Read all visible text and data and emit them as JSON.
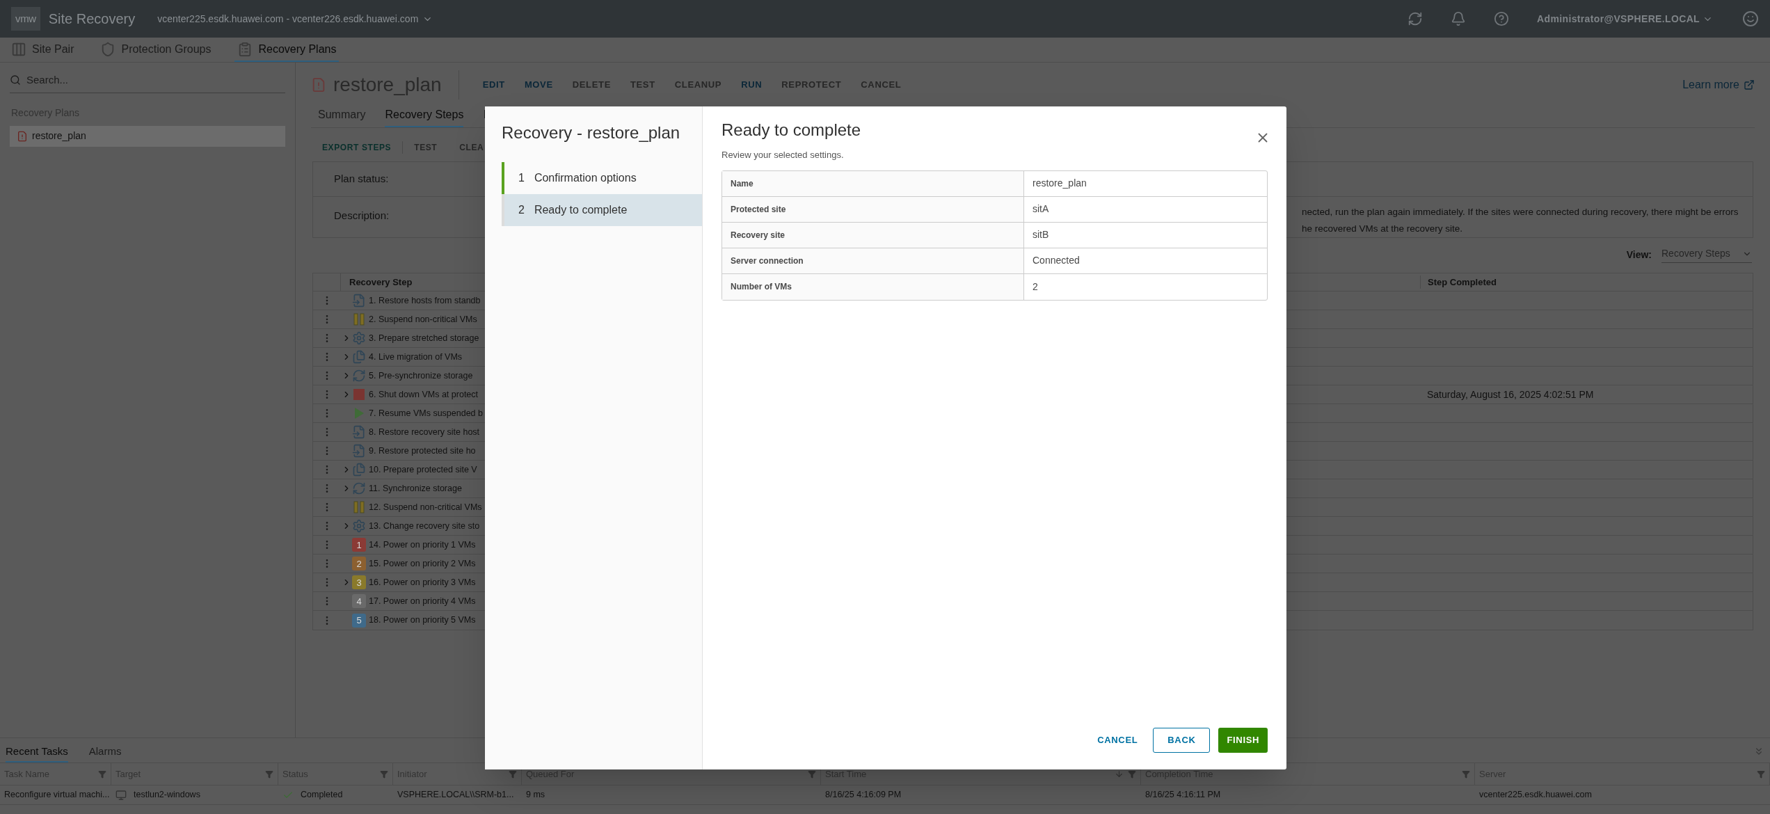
{
  "header": {
    "logo": "vmw",
    "app_title": "Site Recovery",
    "site_pair": "vcenter225.esdk.huawei.com - vcenter226.esdk.huawei.com",
    "user": "Administrator@VSPHERE.LOCAL"
  },
  "nav_tabs": [
    {
      "label": "Site Pair",
      "kind": "columns",
      "selected": false
    },
    {
      "label": "Protection Groups",
      "kind": "shield",
      "selected": false
    },
    {
      "label": "Recovery Plans",
      "kind": "list",
      "selected": true
    }
  ],
  "sidebar": {
    "search": {
      "placeholder": "Search..."
    },
    "section": "Recovery Plans",
    "items": [
      {
        "label": "restore_plan",
        "selected": true
      }
    ]
  },
  "plan": {
    "title": "restore_plan",
    "learn_more": "Learn more",
    "actions": [
      {
        "label": "EDIT",
        "disabled": false
      },
      {
        "label": "MOVE",
        "disabled": false
      },
      {
        "label": "DELETE",
        "disabled": true
      },
      {
        "label": "TEST",
        "disabled": true
      },
      {
        "label": "CLEANUP",
        "disabled": true
      },
      {
        "label": "RUN",
        "disabled": false
      },
      {
        "label": "REPROTECT",
        "disabled": true
      },
      {
        "label": "CANCEL",
        "disabled": true
      }
    ],
    "tabs": [
      {
        "label": "Summary",
        "selected": false
      },
      {
        "label": "Recovery Steps",
        "selected": true
      },
      {
        "label": "I",
        "selected": false
      }
    ],
    "step_actions": [
      {
        "label": "EXPORT STEPS",
        "disabled": false
      },
      {
        "label": "TEST",
        "disabled": true
      },
      {
        "label": "CLEA",
        "disabled": true
      }
    ],
    "status_label": "Plan status:",
    "description_label": "Description:",
    "description_lines": [
      "nected, run the plan again immediately. If the sites were connected during recovery, there might be errors",
      "he recovered VMs at the recovery site."
    ],
    "view_label": "View:",
    "view_value": "Recovery Steps",
    "columns": [
      "Recovery Step",
      "Step Completed"
    ],
    "steps": [
      {
        "name": "1. Restore hosts from standb",
        "kind": "restore",
        "expandable": false
      },
      {
        "name": "2. Suspend non-critical VMs",
        "kind": "pause",
        "expandable": false
      },
      {
        "name": "3. Prepare stretched storage",
        "kind": "gear",
        "expandable": true
      },
      {
        "name": "4. Live migration of VMs",
        "kind": "migrate",
        "expandable": true
      },
      {
        "name": "5. Pre-synchronize storage",
        "kind": "sync",
        "expandable": true
      },
      {
        "name": "6. Shut down VMs at protect",
        "kind": "stop",
        "expandable": true,
        "completed": "Saturday, August 16, 2025 4:02:51 PM"
      },
      {
        "name": "7. Resume VMs suspended b",
        "kind": "play",
        "expandable": false
      },
      {
        "name": "8. Restore recovery site host",
        "kind": "restore",
        "expandable": false
      },
      {
        "name": "9. Restore protected site ho",
        "kind": "restore",
        "expandable": false
      },
      {
        "name": "10. Prepare protected site V",
        "kind": "migrate",
        "expandable": true
      },
      {
        "name": "11. Synchronize storage",
        "kind": "sync",
        "expandable": true
      },
      {
        "name": "12. Suspend non-critical VMs",
        "kind": "pause",
        "expandable": false
      },
      {
        "name": "13. Change recovery site sto",
        "kind": "gear",
        "expandable": true
      },
      {
        "name": "14. Power on priority 1 VMs",
        "kind": "priority",
        "badge": "1",
        "color": "#8b3a35",
        "expandable": false
      },
      {
        "name": "15. Power on priority 2 VMs",
        "kind": "priority",
        "badge": "2",
        "color": "#8c6030",
        "expandable": false
      },
      {
        "name": "16. Power on priority 3 VMs",
        "kind": "priority",
        "badge": "3",
        "color": "#8a7a2b",
        "expandable": true
      },
      {
        "name": "17. Power on priority 4 VMs",
        "kind": "priority",
        "badge": "4",
        "color": "#6a6a6a",
        "expandable": false
      },
      {
        "name": "18. Power on priority 5 VMs",
        "kind": "priority",
        "badge": "5",
        "color": "#3f6a8a",
        "expandable": false
      }
    ]
  },
  "bottom": {
    "tabs": [
      {
        "label": "Recent Tasks",
        "selected": true
      },
      {
        "label": "Alarms",
        "selected": false
      }
    ],
    "columns": [
      "Task Name",
      "Target",
      "Status",
      "Initiator",
      "Queued For",
      "Start Time",
      "Completion Time",
      "Server"
    ],
    "rows": [
      {
        "task": "Reconfigure virtual machi...",
        "target": "testlun2-windows",
        "status": "Completed",
        "initiator": "VSPHERE.LOCAL\\\\SRM-b1...",
        "queued": "9 ms",
        "start": "8/16/25 4:16:09 PM",
        "completion": "8/16/25 4:16:11 PM",
        "server": "vcenter225.esdk.huawei.com"
      }
    ]
  },
  "dialog": {
    "title": "Recovery - restore_plan",
    "steps": [
      {
        "number": "1",
        "label": "Confirmation options",
        "selected": false,
        "completed": true
      },
      {
        "number": "2",
        "label": "Ready to complete",
        "selected": true,
        "completed": false
      }
    ],
    "heading": "Ready to complete",
    "subtitle": "Review your selected settings.",
    "settings": [
      {
        "label": "Name",
        "value": "restore_plan"
      },
      {
        "label": "Protected site",
        "value": "sitA"
      },
      {
        "label": "Recovery site",
        "value": "sitB"
      },
      {
        "label": "Server connection",
        "value": "Connected"
      },
      {
        "label": "Number of VMs",
        "value": "2"
      }
    ],
    "buttons": [
      {
        "label": "CANCEL",
        "kind": "flat"
      },
      {
        "label": "BACK",
        "kind": "outline"
      },
      {
        "label": "FINISH",
        "kind": "primary"
      }
    ]
  }
}
